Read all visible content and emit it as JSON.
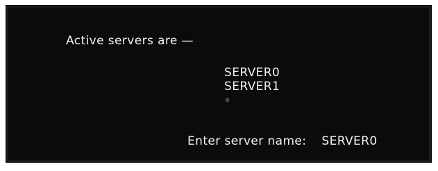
{
  "screen": {
    "heading": "Active servers are —",
    "servers": [
      "SERVER0",
      "SERVER1"
    ],
    "cursor_glyph": "☼",
    "prompt_label": "Enter server name:",
    "prompt_value": "SERVER0"
  }
}
